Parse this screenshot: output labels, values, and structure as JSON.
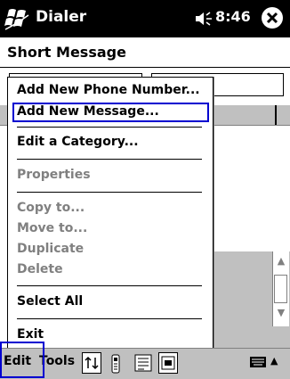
{
  "titlebar": {
    "app_title": "Dialer",
    "time": "8:46"
  },
  "subtitle": "Short Message",
  "menu": {
    "items": [
      {
        "label": "Add New Phone Number...",
        "enabled": true
      },
      {
        "label": "Add New Message...",
        "enabled": true,
        "highlighted": true
      },
      {
        "label": "Edit a Category...",
        "enabled": true
      },
      {
        "label": "Properties",
        "enabled": false
      },
      {
        "label": "Copy to...",
        "enabled": false
      },
      {
        "label": "Move to...",
        "enabled": false
      },
      {
        "label": "Duplicate",
        "enabled": false
      },
      {
        "label": "Delete",
        "enabled": false
      },
      {
        "label": "Select All",
        "enabled": true
      },
      {
        "label": "Exit",
        "enabled": true
      }
    ]
  },
  "bottombar": {
    "edit_label": "Edit",
    "tools_label": "Tools"
  },
  "colors": {
    "titlebar": "#000000",
    "highlight_border": "#0000d0",
    "disabled_text": "#808080",
    "bar_bg": "#c0c0c0"
  }
}
